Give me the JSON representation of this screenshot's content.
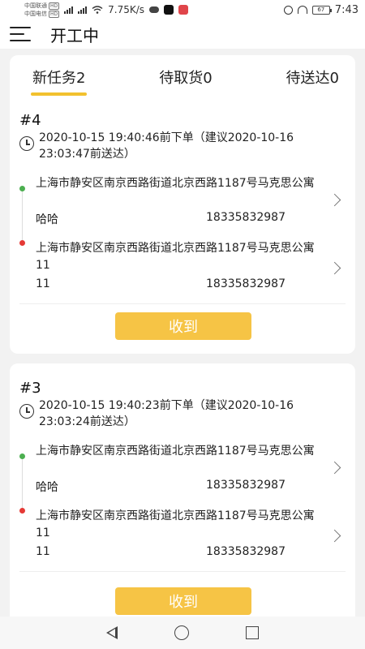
{
  "status_bar": {
    "carrier1": "中国联通",
    "carrier2": "中国电信",
    "hd": "HD",
    "net_speed": "7.75K/s",
    "battery": "67",
    "time": "7:43"
  },
  "header": {
    "title": "开工中"
  },
  "tabs": [
    {
      "label": "新任务2"
    },
    {
      "label": "待取货0"
    },
    {
      "label": "待送达0"
    }
  ],
  "orders": [
    {
      "number": "#4",
      "time_text": "2020-10-15 19:40:46前下单（建议2020-10-16 23:03:47前送达）",
      "pickup": {
        "address": "上海市静安区南京西路街道北京西路1187号马克思公寓",
        "name": "哈哈",
        "phone": "18335832987"
      },
      "delivery": {
        "address": "上海市静安区南京西路街道北京西路1187号马克思公寓11",
        "name": "11",
        "phone": "18335832987"
      },
      "button_label": "收到"
    },
    {
      "number": "#3",
      "time_text": "2020-10-15 19:40:23前下单（建议2020-10-16 23:03:24前送达）",
      "pickup": {
        "address": "上海市静安区南京西路街道北京西路1187号马克思公寓",
        "name": "哈哈",
        "phone": "18335832987"
      },
      "delivery": {
        "address": "上海市静安区南京西路街道北京西路1187号马克思公寓11",
        "name": "11",
        "phone": "18335832987"
      },
      "button_label": "收到"
    }
  ],
  "colors": {
    "accent": "#f6c445",
    "tab_underline": "#f2c12e",
    "pickup_dot": "#4caf50",
    "delivery_dot": "#e53935"
  }
}
